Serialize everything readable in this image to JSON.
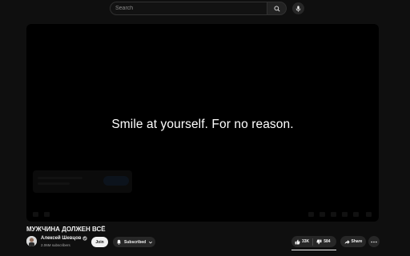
{
  "search": {
    "placeholder": "Search"
  },
  "icons": {
    "search": "search-icon",
    "mic": "microphone-icon",
    "verified": "verified-check-icon",
    "bell": "bell-icon",
    "chevron": "chevron-down-icon",
    "like": "thumbs-up-icon",
    "dislike": "thumbs-down-icon",
    "share": "share-arrow-icon",
    "more": "more-horizontal-icon"
  },
  "player": {
    "caption": "Smile at yourself. For no reason."
  },
  "video": {
    "title": "МУЖЧИНА ДОЛЖЕН ВСЁ"
  },
  "channel": {
    "name": "Алексей Шевцов",
    "subscribers": "2.06M subscribers"
  },
  "actions": {
    "join_label": "Join",
    "subscribed_label": "Subscribed",
    "likes": "33K",
    "dislikes": "584",
    "share_label": "Share"
  },
  "colors": {
    "background": "#0f0f0f",
    "button_bg": "#272727",
    "join_bg": "#f1f1f1"
  }
}
